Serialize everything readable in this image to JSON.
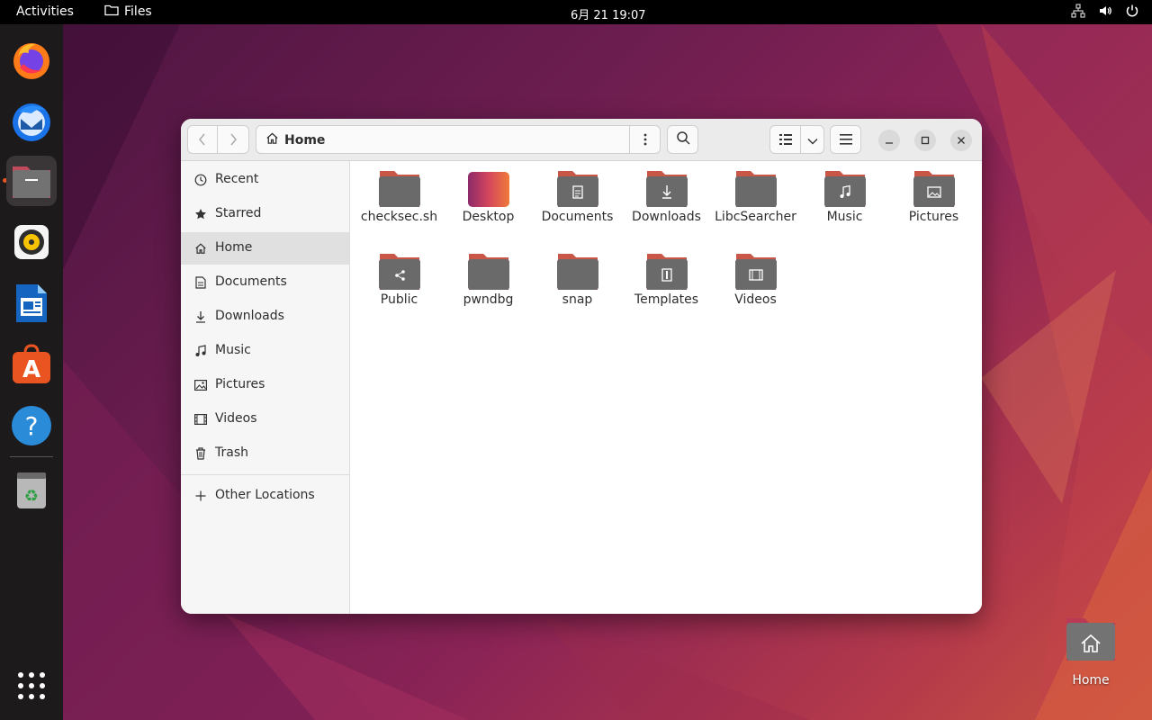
{
  "topbar": {
    "activities": "Activities",
    "app_name": "Files",
    "clock": "6月 21  19:07"
  },
  "dock": {
    "items": [
      {
        "name": "firefox-icon"
      },
      {
        "name": "thunderbird-icon"
      },
      {
        "name": "files-icon",
        "active": true
      },
      {
        "name": "rhythmbox-icon"
      },
      {
        "name": "libreoffice-writer-icon"
      },
      {
        "name": "app-center-icon"
      },
      {
        "name": "help-icon"
      },
      {
        "name": "trash-icon"
      },
      {
        "name": "show-apps-icon"
      }
    ]
  },
  "window": {
    "location": "Home",
    "sidebar": {
      "items": [
        {
          "label": "Recent",
          "icon": "clock-icon"
        },
        {
          "label": "Starred",
          "icon": "star-icon"
        },
        {
          "label": "Home",
          "icon": "home-icon",
          "selected": true
        },
        {
          "label": "Documents",
          "icon": "document-icon"
        },
        {
          "label": "Downloads",
          "icon": "download-icon"
        },
        {
          "label": "Music",
          "icon": "music-icon"
        },
        {
          "label": "Pictures",
          "icon": "picture-icon"
        },
        {
          "label": "Videos",
          "icon": "video-icon"
        },
        {
          "label": "Trash",
          "icon": "trash-icon"
        }
      ],
      "other_locations": "Other Locations"
    },
    "files": [
      {
        "name": "checksec.sh",
        "emblem": "none"
      },
      {
        "name": "Desktop",
        "emblem": "desktop"
      },
      {
        "name": "Documents",
        "emblem": "document"
      },
      {
        "name": "Downloads",
        "emblem": "download"
      },
      {
        "name": "LibcSearcher",
        "emblem": "none"
      },
      {
        "name": "Music",
        "emblem": "music"
      },
      {
        "name": "Pictures",
        "emblem": "picture"
      },
      {
        "name": "Public",
        "emblem": "share"
      },
      {
        "name": "pwndbg",
        "emblem": "none"
      },
      {
        "name": "snap",
        "emblem": "none"
      },
      {
        "name": "Templates",
        "emblem": "template"
      },
      {
        "name": "Videos",
        "emblem": "video"
      }
    ]
  },
  "desktop": {
    "home_label": "Home"
  },
  "colors": {
    "accent": "#e95420",
    "folder_body": "#6a6a6a",
    "folder_tab": "#a8334e"
  }
}
